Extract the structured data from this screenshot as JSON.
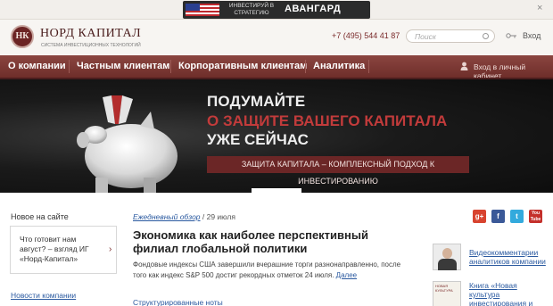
{
  "promo": {
    "text": "ИНВЕСТИРУЙ В СТРАТЕГИЮ",
    "brand": "АВАНГАРД",
    "close": "×"
  },
  "header": {
    "logo_mark": "НК",
    "logo_name": "НОРД КАПИТАЛ",
    "logo_tagline": "СИСТЕМА ИНВЕСТИЦИОННЫХ ТЕХНОЛОГИЙ",
    "phone": "+7 (495) 544 41 87",
    "search_placeholder": "Поиск",
    "login": "Вход"
  },
  "nav": {
    "items": [
      "О компании",
      "Частным клиентам",
      "Корпоративным клиентам",
      "Аналитика"
    ],
    "cabinet": "Вход в личный кабинет"
  },
  "banner": {
    "line1": "ПОДУМАЙТЕ",
    "line2": "О ЗАЩИТЕ ВАШЕГО КАПИТАЛА",
    "line3": "УЖЕ СЕЙЧАС",
    "button": "ЗАЩИТА КАПИТАЛА – КОМПЛЕКСНЫЙ ПОДХОД К ИНВЕСТИРОВАНИЮ"
  },
  "sidebar_left": {
    "title": "Новое на сайте",
    "card_text": "Что готовит нам август? – взгляд ИГ «Норд-Капитал»",
    "card_arrow": "›",
    "news_link": "Новости компании"
  },
  "main": {
    "crumb_link": "Ежедневный обзор",
    "crumb_date": " / 29 июля",
    "title": "Экономика как наиболее перспективный филиал глобальной политики",
    "text": "Фондовые индексы США завершили вчерашние торги разнонаправленно, после того как индекс S&P 500 достиг рекордных отметок 24 июля.",
    "more": "Далее",
    "sub_link": "Структурированные ноты"
  },
  "social": {
    "gplus": "g+",
    "facebook": "f",
    "twitter": "t",
    "youtube": "You Tube"
  },
  "sidebar_right": {
    "video_link": "Видеокомментарии аналитиков компании",
    "book_cover": "НОВАЯ КУЛЬТУРА",
    "book_link": "Книга «Новая культура инвестирования и"
  },
  "colors": {
    "brand": "#6e2e2a",
    "accent_red": "#c23b3b",
    "link": "#2b5aa0"
  }
}
